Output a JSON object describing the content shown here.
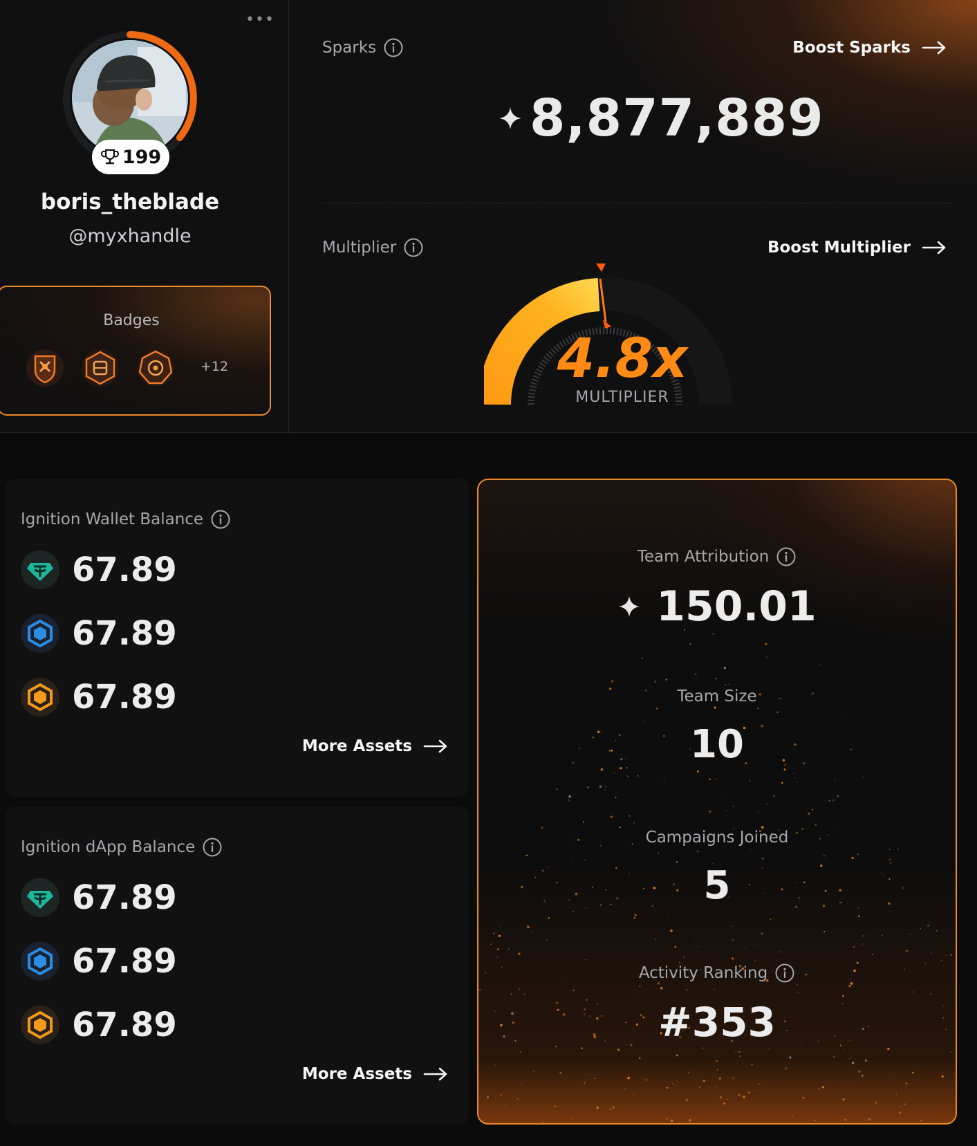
{
  "profile": {
    "more_label": "•••",
    "trophy_count": "199",
    "username": "boris_theblade",
    "handle": "@myxhandle",
    "badges_title": "Badges",
    "badges_more": "+12"
  },
  "sparks": {
    "label": "Sparks",
    "boost_label": "Boost Sparks",
    "value": "8,877,889"
  },
  "multiplier": {
    "label": "Multiplier",
    "boost_label": "Boost Multiplier",
    "value": "4.8x",
    "caption": "MULTIPLIER"
  },
  "wallet": {
    "label": "Ignition Wallet Balance",
    "assets": [
      {
        "icon": "tether-icon",
        "value": "67.89"
      },
      {
        "icon": "blue-hexagon-token-icon",
        "value": "67.89"
      },
      {
        "icon": "orange-hexagon-token-icon",
        "value": "67.89"
      }
    ],
    "more_label": "More Assets"
  },
  "dapp": {
    "label": "Ignition dApp Balance",
    "assets": [
      {
        "icon": "tether-icon",
        "value": "67.89"
      },
      {
        "icon": "blue-hexagon-token-icon",
        "value": "67.89"
      },
      {
        "icon": "orange-hexagon-token-icon",
        "value": "67.89"
      }
    ],
    "more_label": "More Assets"
  },
  "team": {
    "attribution_label": "Team Attribution",
    "attribution_value": "150.01",
    "size_label": "Team Size",
    "size_value": "10",
    "campaigns_label": "Campaigns Joined",
    "campaigns_value": "5",
    "ranking_label": "Activity Ranking",
    "ranking_value": "#353"
  },
  "colors": {
    "accent": "#e8892b",
    "multiplier": "#ff8a14",
    "tether": "#1fb59b",
    "blue_token": "#2a8ee6",
    "orange_token": "#f39a1c"
  }
}
